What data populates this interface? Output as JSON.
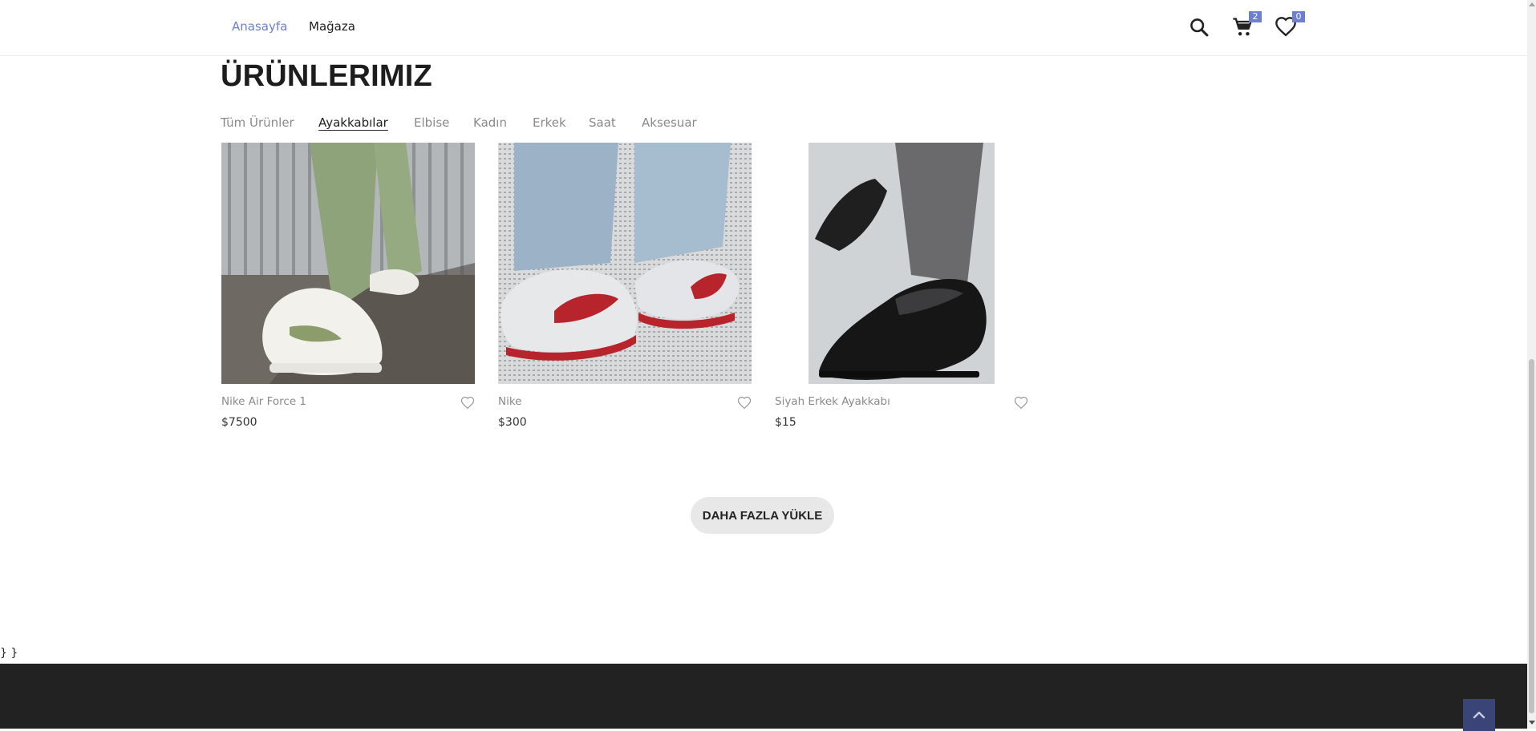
{
  "header": {
    "nav": [
      {
        "label": "Anasayfa"
      },
      {
        "label": "Mağaza"
      }
    ],
    "cart_count": "2",
    "wishlist_count": "0"
  },
  "section": {
    "title": "ÜRÜNLERIMIZ",
    "filters": [
      {
        "label": "Tüm Ürünler"
      },
      {
        "label": "Ayakkabılar"
      },
      {
        "label": "Elbise"
      },
      {
        "label": "Kadın"
      },
      {
        "label": "Erkek"
      },
      {
        "label": "Saat"
      },
      {
        "label": "Aksesuar"
      }
    ],
    "active_filter": "Ayakkabılar"
  },
  "products": [
    {
      "name": "Nike Air Force 1",
      "price": "$7500"
    },
    {
      "name": "Nike",
      "price": "$300"
    },
    {
      "name": "Siyah Erkek Ayakkabı",
      "price": "$15"
    }
  ],
  "load_more_label": "DAHA FAZLA YÜKLE",
  "stray_text": "} }",
  "colors": {
    "accent": "#6d7fd1",
    "footer": "#222222",
    "back_to_top": "#3b4477",
    "button_bg": "#e8e8e8"
  }
}
